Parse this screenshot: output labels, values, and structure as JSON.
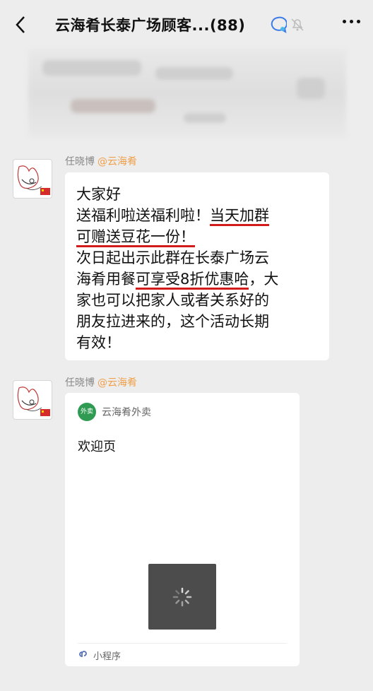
{
  "header": {
    "title": "云海肴长泰广场顾客...",
    "count": "(88)"
  },
  "messages": [
    {
      "sender": "任晓博",
      "tag": "@云海肴",
      "lines": [
        "大家好",
        "送福利啦送福利啦！",
        "当天加群",
        "可赠送豆花一份！",
        "次日起出示此群在长泰广场云",
        "海肴用",
        "餐",
        "可享受8折优惠哈",
        "，大",
        "家也可以把家人或者关系好的",
        "朋友拉进来的，这个活动长期",
        "有效！"
      ]
    },
    {
      "sender": "任晓博",
      "tag": "@云海肴",
      "mini_program": {
        "logo_text": "外卖",
        "name": "云海肴外卖",
        "title": "欢迎页",
        "footer_label": "小程序"
      }
    }
  ],
  "colors": {
    "underline": "#d31b1b",
    "tag": "#f0a04b",
    "mini_logo": "#2f9b52"
  }
}
